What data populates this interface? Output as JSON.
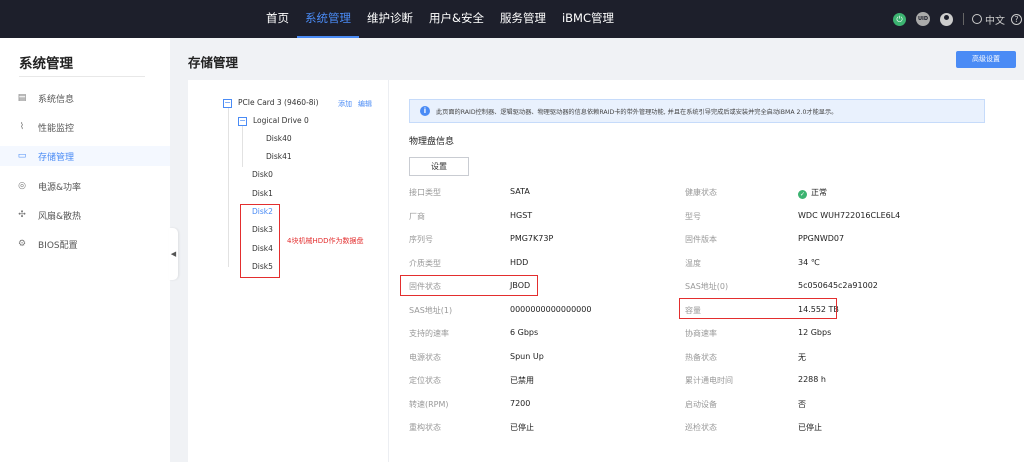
{
  "topnav": {
    "items": [
      "首页",
      "系统管理",
      "维护诊断",
      "用户&安全",
      "服务管理",
      "iBMC管理"
    ],
    "active_index": 1
  },
  "header_right": {
    "uid_label": "UID",
    "lang_label": "中文",
    "icons": [
      "power-icon",
      "uid-icon",
      "user-icon",
      "globe-icon",
      "help-icon"
    ]
  },
  "sidebar": {
    "title": "系统管理",
    "items": [
      {
        "label": "系统信息",
        "icon": "system-info-icon"
      },
      {
        "label": "性能监控",
        "icon": "performance-icon"
      },
      {
        "label": "存储管理",
        "icon": "storage-icon",
        "active": true
      },
      {
        "label": "电源&功率",
        "icon": "power-supply-icon"
      },
      {
        "label": "风扇&散热",
        "icon": "fan-icon"
      },
      {
        "label": "BIOS配置",
        "icon": "bios-icon"
      }
    ]
  },
  "page": {
    "title": "存储管理",
    "advanced_button": "高级设置"
  },
  "tree": {
    "root": "PCIe Card 3 (9460-8i)",
    "add_label": "添加",
    "edit_label": "编辑",
    "logical_drive": "Logical Drive 0",
    "ld_disks": [
      "Disk40",
      "Disk41"
    ],
    "disks": [
      "Disk0",
      "Disk1",
      "Disk2",
      "Disk3",
      "Disk4",
      "Disk5"
    ],
    "selected": "Disk2",
    "annotation": "4块机械HDD作为数据盘"
  },
  "info_bar": {
    "text": "此页面的RAID控制器、逻辑驱动器、物理驱动器的信息依赖RAID卡的带外管理功能, 并且在系统引导完成后或安装并完全启动iBMA 2.0才能显示。"
  },
  "physical_disk": {
    "section_title": "物理盘信息",
    "settings_button": "设置",
    "left": [
      {
        "label": "接口类型",
        "value": "SATA"
      },
      {
        "label": "厂商",
        "value": "HGST"
      },
      {
        "label": "序列号",
        "value": "PMG7K73P"
      },
      {
        "label": "介质类型",
        "value": "HDD"
      },
      {
        "label": "固件状态",
        "value": "JBOD"
      },
      {
        "label": "SAS地址(1)",
        "value": "0000000000000000"
      },
      {
        "label": "支持的速率",
        "value": "6 Gbps"
      },
      {
        "label": "电源状态",
        "value": "Spun Up"
      },
      {
        "label": "定位状态",
        "value": "已禁用"
      },
      {
        "label": "转速(RPM)",
        "value": "7200"
      },
      {
        "label": "重构状态",
        "value": "已停止"
      }
    ],
    "right": [
      {
        "label": "健康状态",
        "value": "正常"
      },
      {
        "label": "型号",
        "value": "WDC WUH722016CLE6L4"
      },
      {
        "label": "固件版本",
        "value": "PPGNWD07"
      },
      {
        "label": "温度",
        "value": "34 ℃"
      },
      {
        "label": "SAS地址(0)",
        "value": "5c050645c2a91002"
      },
      {
        "label": "容量",
        "value": "14.552 TB"
      },
      {
        "label": "协商速率",
        "value": "12 Gbps"
      },
      {
        "label": "热备状态",
        "value": "无"
      },
      {
        "label": "累计通电时间",
        "value": "2288 h"
      },
      {
        "label": "启动设备",
        "value": "否"
      },
      {
        "label": "巡检状态",
        "value": "已停止"
      }
    ]
  },
  "colors": {
    "accent": "#4a8bf5",
    "topbar": "#1d1f2b",
    "highlight_red": "#e32e2e",
    "ok_green": "#3cb371"
  }
}
